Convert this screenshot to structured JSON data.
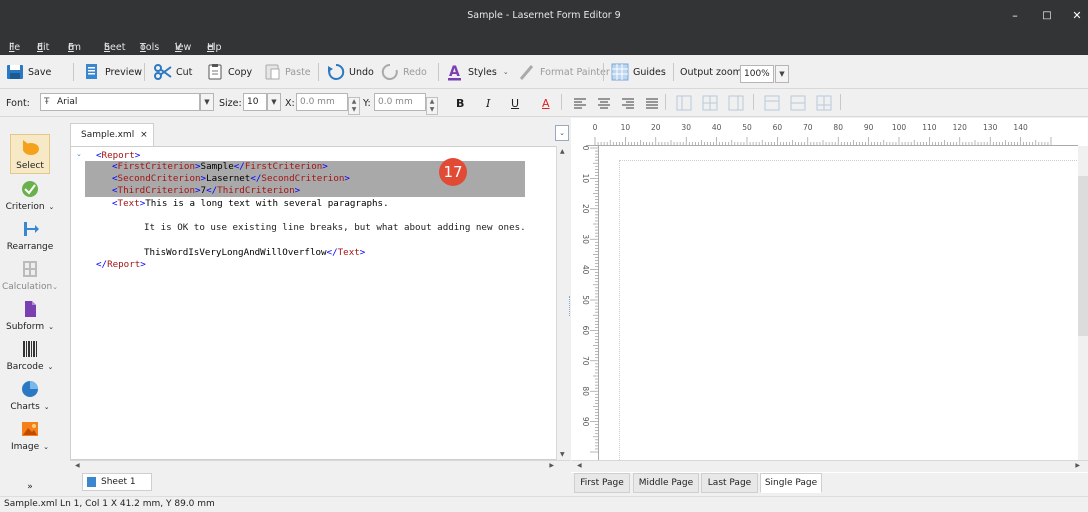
{
  "window": {
    "title": "Sample - Lasernet Form Editor 9",
    "min": "–",
    "max": "□",
    "close": "✕"
  },
  "menu": [
    {
      "label": "File",
      "u": "F",
      "rest": "ile"
    },
    {
      "label": "Edit",
      "u": "E",
      "rest": "dit"
    },
    {
      "label": "Form",
      "pre": "F",
      "u": "o",
      "rest": "rm"
    },
    {
      "label": "Sheet",
      "u": "S",
      "rest": "heet"
    },
    {
      "label": "Tools",
      "u": "T",
      "rest": "ools"
    },
    {
      "label": "View",
      "u": "V",
      "rest": "iew"
    },
    {
      "label": "Help",
      "u": "H",
      "rest": "elp"
    }
  ],
  "toolbar1": {
    "save": "Save",
    "preview": "Preview",
    "cut": "Cut",
    "copy": "Copy",
    "paste": "Paste",
    "undo": "Undo",
    "redo": "Redo",
    "styles": "Styles",
    "format_painter": "Format Painter",
    "guides": "Guides",
    "output_zoom_label": "Output zoom:",
    "output_zoom_value": "100%"
  },
  "toolbar2": {
    "font_label": "Font:",
    "font_value": "Arial",
    "size_label": "Size:",
    "size_value": "10",
    "x_label": "X:",
    "x_value": "0.0 mm",
    "y_label": "Y:",
    "y_value": "0.0 mm",
    "bold": "B",
    "italic": "I",
    "underline": "U",
    "font_color": "A"
  },
  "leftbar": [
    {
      "label": "Select",
      "icon": "select-pointer-icon",
      "dropdown": false
    },
    {
      "label": "Criterion",
      "icon": "criterion-check-icon",
      "dropdown": true
    },
    {
      "label": "Rearrange",
      "icon": "rearrange-arrow-icon",
      "dropdown": false
    },
    {
      "label": "Calculation",
      "icon": "calculation-icon",
      "dropdown": true
    },
    {
      "label": "Subform",
      "icon": "subform-document-icon",
      "dropdown": true
    },
    {
      "label": "Barcode",
      "icon": "barcode-icon",
      "dropdown": true
    },
    {
      "label": "Charts",
      "icon": "pie-chart-icon",
      "dropdown": true
    },
    {
      "label": "Image",
      "icon": "image-icon",
      "dropdown": true
    }
  ],
  "editor": {
    "tab": "Sample.xml",
    "tab_close": "×",
    "lines": [
      "<Report>",
      "<FirstCriterion>Sample</FirstCriterion>",
      "<SecondCriterion>Lasernet</SecondCriterion>",
      "<ThirdCriterion>7</ThirdCriterion>",
      "<Text>This is a long text with several paragraphs.",
      "",
      "It is OK to use existing line breaks, but what about adding new ones.",
      "",
      "ThisWordIsVeryLongAndWillOverflow</Text>",
      "</Report>"
    ],
    "sheet_tab": "Sheet 1"
  },
  "badge": "17",
  "ruler_top": [
    "0",
    "10",
    "20",
    "30",
    "40",
    "50",
    "60",
    "70",
    "80",
    "90",
    "100",
    "110",
    "120",
    "130",
    "140"
  ],
  "ruler_left": [
    "0",
    "10",
    "20",
    "30",
    "40",
    "50",
    "60",
    "70",
    "80",
    "90"
  ],
  "page_tabs": [
    "First Page",
    "Middle Page",
    "Last Page",
    "Single Page"
  ],
  "status": "Sample.xml  Ln 1, Col 1  X 41.2 mm, Y 89.0 mm",
  "colors": {
    "titlebar": "#333436",
    "highlight": "#a9a9a9",
    "xml_tag": "#a31515",
    "xml_bracket": "#0000ff",
    "badge": "#e14b36"
  }
}
